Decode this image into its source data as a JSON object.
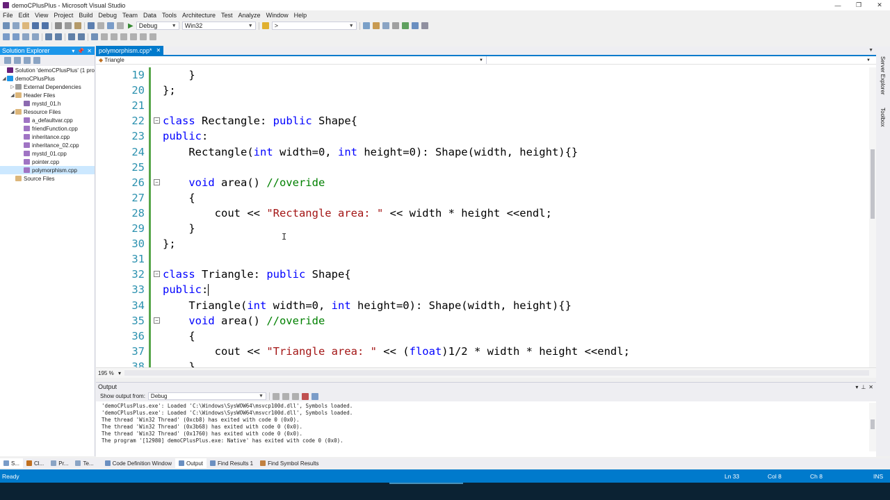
{
  "window": {
    "title": "demoCPlusPlus - Microsoft Visual Studio",
    "controls": [
      "—",
      "❐",
      "✕"
    ]
  },
  "menu": [
    "File",
    "Edit",
    "View",
    "Project",
    "Build",
    "Debug",
    "Team",
    "Data",
    "Tools",
    "Architecture",
    "Test",
    "Analyze",
    "Window",
    "Help"
  ],
  "toolbar": {
    "config": "Debug",
    "platform": "Win32",
    "find_box": ">"
  },
  "solution_explorer": {
    "title": "Solution Explorer",
    "items": [
      {
        "label": "Solution 'demoCPlusPlus' (1 pro",
        "level": 0,
        "icon": "solution-icon",
        "expander": ""
      },
      {
        "label": "demoCPlusPlus",
        "level": 0,
        "icon": "project-icon",
        "expander": "◢"
      },
      {
        "label": "External Dependencies",
        "level": 1,
        "icon": "dependencies-icon",
        "expander": "▷"
      },
      {
        "label": "Header Files",
        "level": 1,
        "icon": "folder-icon",
        "expander": "◢"
      },
      {
        "label": "mystd_01.h",
        "level": 2,
        "icon": "header-file-icon",
        "expander": ""
      },
      {
        "label": "Resource Files",
        "level": 1,
        "icon": "folder-icon",
        "expander": "◢"
      },
      {
        "label": "a_defaultvar.cpp",
        "level": 2,
        "icon": "cpp-file-icon",
        "expander": ""
      },
      {
        "label": "friendFunction.cpp",
        "level": 2,
        "icon": "cpp-file-icon",
        "expander": ""
      },
      {
        "label": "inheritance.cpp",
        "level": 2,
        "icon": "cpp-file-icon",
        "expander": ""
      },
      {
        "label": "inheritance_02.cpp",
        "level": 2,
        "icon": "cpp-file-icon",
        "expander": ""
      },
      {
        "label": "mystd_01.cpp",
        "level": 2,
        "icon": "cpp-file-icon",
        "expander": ""
      },
      {
        "label": "pointer.cpp",
        "level": 2,
        "icon": "cpp-file-icon",
        "expander": ""
      },
      {
        "label": "polymorphism.cpp",
        "level": 2,
        "icon": "cpp-file-icon",
        "expander": "",
        "selected": true
      },
      {
        "label": "Source Files",
        "level": 1,
        "icon": "folder-icon",
        "expander": ""
      }
    ]
  },
  "editor": {
    "tab_label": "polymorphism.cpp*",
    "tab_close": "✕",
    "nav_scope": "Triangle",
    "zoom": "195 %",
    "lines": [
      {
        "n": "19",
        "fold": "",
        "segs": [
          [
            "p",
            "    }"
          ]
        ]
      },
      {
        "n": "20",
        "fold": "",
        "segs": [
          [
            "p",
            "};"
          ]
        ]
      },
      {
        "n": "21",
        "fold": "",
        "segs": [
          [
            "p",
            ""
          ]
        ]
      },
      {
        "n": "22",
        "fold": "−",
        "segs": [
          [
            "k",
            "class"
          ],
          [
            "p",
            " Rectangle: "
          ],
          [
            "k",
            "public"
          ],
          [
            "p",
            " Shape{"
          ]
        ]
      },
      {
        "n": "23",
        "fold": "",
        "segs": [
          [
            "k",
            "public"
          ],
          [
            "p",
            ":"
          ]
        ]
      },
      {
        "n": "24",
        "fold": "",
        "segs": [
          [
            "p",
            "    Rectangle("
          ],
          [
            "k",
            "int"
          ],
          [
            "p",
            " width=0, "
          ],
          [
            "k",
            "int"
          ],
          [
            "p",
            " height=0): Shape(width, height){}"
          ]
        ]
      },
      {
        "n": "25",
        "fold": "",
        "segs": [
          [
            "p",
            ""
          ]
        ]
      },
      {
        "n": "26",
        "fold": "−",
        "segs": [
          [
            "p",
            "    "
          ],
          [
            "k",
            "void"
          ],
          [
            "p",
            " area() "
          ],
          [
            "c",
            "//overide"
          ]
        ]
      },
      {
        "n": "27",
        "fold": "",
        "segs": [
          [
            "p",
            "    {"
          ]
        ]
      },
      {
        "n": "28",
        "fold": "",
        "segs": [
          [
            "p",
            "        cout << "
          ],
          [
            "s",
            "\"Rectangle area: \""
          ],
          [
            "p",
            " << width * height <<endl;"
          ]
        ]
      },
      {
        "n": "29",
        "fold": "",
        "segs": [
          [
            "p",
            "    }"
          ]
        ]
      },
      {
        "n": "30",
        "fold": "",
        "segs": [
          [
            "p",
            "};"
          ]
        ]
      },
      {
        "n": "31",
        "fold": "",
        "segs": [
          [
            "p",
            ""
          ]
        ]
      },
      {
        "n": "32",
        "fold": "−",
        "segs": [
          [
            "k",
            "class"
          ],
          [
            "p",
            " Triangle: "
          ],
          [
            "k",
            "public"
          ],
          [
            "p",
            " Shape{"
          ]
        ]
      },
      {
        "n": "33",
        "fold": "",
        "segs": [
          [
            "k",
            "public"
          ],
          [
            "p",
            ":"
          ]
        ],
        "caret": true
      },
      {
        "n": "34",
        "fold": "",
        "segs": [
          [
            "p",
            "    Triangle("
          ],
          [
            "k",
            "int"
          ],
          [
            "p",
            " width=0, "
          ],
          [
            "k",
            "int"
          ],
          [
            "p",
            " height=0): Shape(width, height){}"
          ]
        ]
      },
      {
        "n": "35",
        "fold": "−",
        "segs": [
          [
            "p",
            "    "
          ],
          [
            "k",
            "void"
          ],
          [
            "p",
            " area() "
          ],
          [
            "c",
            "//overide"
          ]
        ]
      },
      {
        "n": "36",
        "fold": "",
        "segs": [
          [
            "p",
            "    {"
          ]
        ]
      },
      {
        "n": "37",
        "fold": "",
        "segs": [
          [
            "p",
            "        cout << "
          ],
          [
            "s",
            "\"Triangle area: \""
          ],
          [
            "p",
            " << ("
          ],
          [
            "k",
            "float"
          ],
          [
            "p",
            ")1/2 * width * height <<endl;"
          ]
        ]
      },
      {
        "n": "38",
        "fold": "",
        "segs": [
          [
            "p",
            "    }"
          ]
        ]
      }
    ]
  },
  "output": {
    "title": "Output",
    "show_from_label": "Show output from:",
    "show_from_value": "Debug",
    "lines": [
      "'demoCPlusPlus.exe': Loaded 'C:\\Windows\\SysWOW64\\msvcp100d.dll', Symbols loaded.",
      "'demoCPlusPlus.exe': Loaded 'C:\\Windows\\SysWOW64\\msvcr100d.dll', Symbols loaded.",
      "The thread 'Win32 Thread' (0xcb8) has exited with code 0 (0x0).",
      "The thread 'Win32 Thread' (0x3b68) has exited with code 0 (0x0).",
      "The thread 'Win32 Thread' (0x1760) has exited with code 0 (0x0).",
      "The program '[12980] demoCPlusPlus.exe: Native' has exited with code 0 (0x0)."
    ]
  },
  "side_tabs": [
    "Server Explorer",
    "Toolbox"
  ],
  "bottom_tabs": {
    "left": [
      "S...",
      "Cl...",
      "Pr...",
      "Te..."
    ],
    "main": [
      "Code Definition Window",
      "Output",
      "Find Results 1",
      "Find Symbol Results"
    ],
    "active": "Output"
  },
  "status": {
    "state": "Ready",
    "line": "Ln 33",
    "col": "Col 8",
    "ch": "Ch 8",
    "mode": "INS"
  },
  "colors": {
    "accent": "#007ACC",
    "keyword": "#0000FF",
    "string": "#A31515",
    "comment": "#008000",
    "line_number": "#2B91AF"
  }
}
